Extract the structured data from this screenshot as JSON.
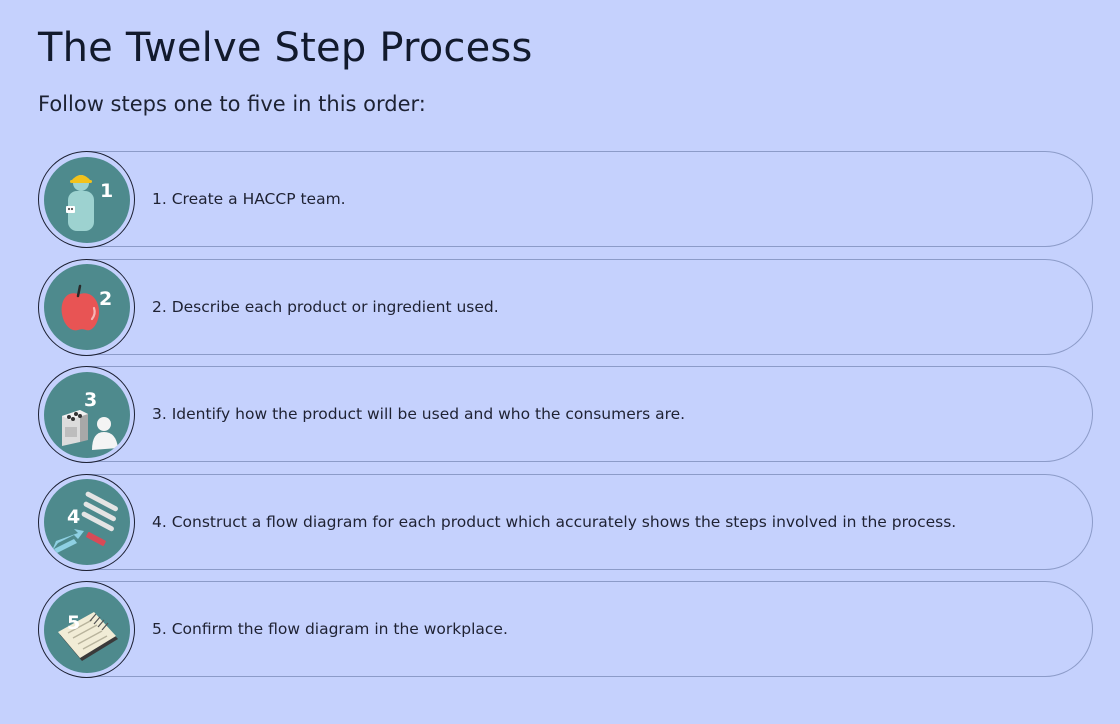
{
  "page": {
    "title": "The Twelve Step Process",
    "subtitle": "Follow steps one to five in this order:"
  },
  "steps": [
    {
      "number": "1",
      "text": "1. Create a HACCP team.",
      "icon": "team-member-icon"
    },
    {
      "number": "2",
      "text": "2. Describe each product or ingredient used.",
      "icon": "apple-icon"
    },
    {
      "number": "3",
      "text": "3. Identify how the product will be used and who the consumers are.",
      "icon": "stove-consumer-icon"
    },
    {
      "number": "4",
      "text": "4. Construct a flow diagram for each product which accurately shows the steps involved in the process.",
      "icon": "flow-diagram-icon"
    },
    {
      "number": "5",
      "text": "5. Confirm the flow diagram in the workplace.",
      "icon": "notepad-icon"
    }
  ],
  "colors": {
    "background": "#c5d1fd",
    "badge_fill": "#4e8a8d",
    "badge_ring": "#1c2033",
    "pill_border": "#8c9bc8"
  }
}
